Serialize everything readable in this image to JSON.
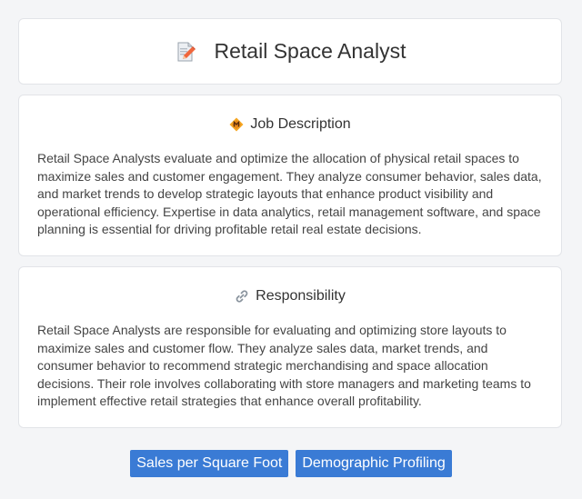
{
  "header": {
    "title": "Retail Space Analyst",
    "icon": "document-edit-icon"
  },
  "job_description": {
    "icon": "badge-icon",
    "title": "Job Description",
    "text": "Retail Space Analysts evaluate and optimize the allocation of physical retail spaces to maximize sales and customer engagement. They analyze consumer behavior, sales data, and market trends to develop strategic layouts that enhance product visibility and operational efficiency. Expertise in data analytics, retail management software, and space planning is essential for driving profitable retail real estate decisions."
  },
  "responsibility": {
    "icon": "link-icon",
    "title": "Responsibility",
    "text": "Retail Space Analysts are responsible for evaluating and optimizing store layouts to maximize sales and customer flow. They analyze sales data, market trends, and consumer behavior to recommend strategic merchandising and space allocation decisions. Their role involves collaborating with store managers and marketing teams to implement effective retail strategies that enhance overall profitability."
  },
  "skills": [
    "Sales per Square Foot",
    "Demographic Profiling"
  ],
  "colors": {
    "accent": "#3a7bd5",
    "background": "#f4f5f7"
  }
}
